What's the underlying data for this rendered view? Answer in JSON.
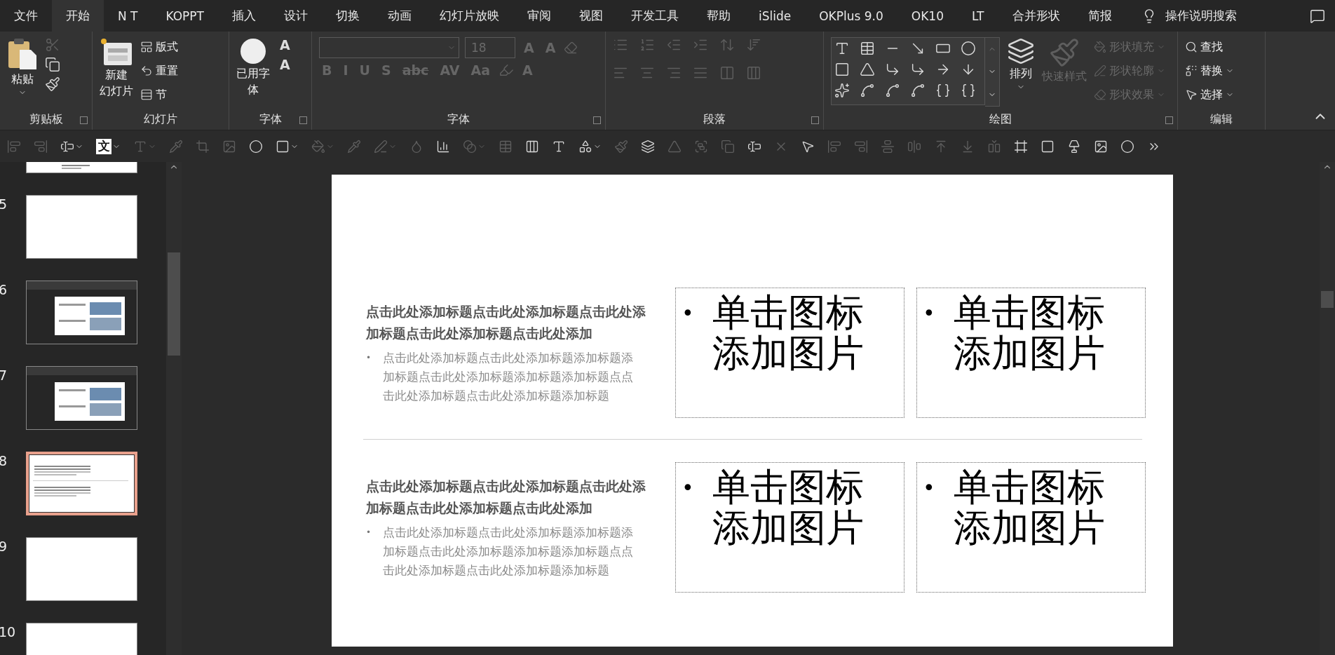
{
  "menu_tabs": [
    {
      "label": "文件",
      "selected": false
    },
    {
      "label": "开始",
      "selected": true
    },
    {
      "label": "N T",
      "selected": false
    },
    {
      "label": "KOPPT",
      "selected": false
    },
    {
      "label": "插入",
      "selected": false
    },
    {
      "label": "设计",
      "selected": false
    },
    {
      "label": "切换",
      "selected": false
    },
    {
      "label": "动画",
      "selected": false
    },
    {
      "label": "幻灯片放映",
      "selected": false
    },
    {
      "label": "审阅",
      "selected": false
    },
    {
      "label": "视图",
      "selected": false
    },
    {
      "label": "开发工具",
      "selected": false
    },
    {
      "label": "帮助",
      "selected": false
    },
    {
      "label": "iSlide",
      "selected": false
    },
    {
      "label": "OKPlus 9.0",
      "selected": false
    },
    {
      "label": "OK10",
      "selected": false
    },
    {
      "label": "LT",
      "selected": false
    },
    {
      "label": "合并形状",
      "selected": false
    },
    {
      "label": "简报",
      "selected": false
    }
  ],
  "tell_me": "操作说明搜索",
  "ribbon": {
    "groups": [
      {
        "kind": "clipboard",
        "label": "剪贴板",
        "paste": "粘贴",
        "tools": [
          {
            "disabled": true
          },
          {
            "disabled": false
          },
          {
            "disabled": false
          }
        ]
      },
      {
        "kind": "slides",
        "label": "幻灯片",
        "new_slide": [
          "新建",
          "幻灯片"
        ],
        "items": [
          "版式",
          "重置",
          "节"
        ]
      },
      {
        "kind": "fonts_used",
        "label": "字体",
        "button": [
          "已用字",
          "体"
        ],
        "size_buttons": [
          "A",
          "A"
        ]
      },
      {
        "kind": "font",
        "label": "字体",
        "font_size": "18",
        "disabled": true,
        "size_buttons": [
          "A",
          "A"
        ],
        "format_buttons": [
          "B",
          "I",
          "U",
          "S",
          "abc",
          "AV",
          "Aa"
        ],
        "color_button": "A"
      },
      {
        "kind": "paragraph",
        "label": "段落",
        "disabled": true
      },
      {
        "kind": "drawing",
        "label": "绘图",
        "arrange": "排列",
        "quick_styles": {
          "label": "快速样式",
          "disabled": true
        },
        "shape_options": [
          {
            "label": "形状填充",
            "disabled": true
          },
          {
            "label": "形状轮廓",
            "disabled": true
          },
          {
            "label": "形状效果",
            "disabled": true
          }
        ]
      },
      {
        "kind": "editing",
        "label": "编辑",
        "items": [
          "查找",
          "替换",
          "选择"
        ]
      }
    ]
  },
  "quick_toolbar": [
    {
      "kind": "icon",
      "disabled": true
    },
    {
      "kind": "icon",
      "disabled": true
    },
    {
      "kind": "icon",
      "disabled": false,
      "caret": true
    },
    {
      "kind": "glyph",
      "label": "文",
      "disabled": false,
      "caret": true
    },
    {
      "kind": "icon",
      "disabled": true,
      "caret": true
    },
    {
      "kind": "icon",
      "disabled": true
    },
    {
      "kind": "icon",
      "disabled": true
    },
    {
      "kind": "icon",
      "disabled": true
    },
    {
      "kind": "icon",
      "disabled": false
    },
    {
      "kind": "icon",
      "disabled": false,
      "caret": true
    },
    {
      "kind": "icon",
      "disabled": true,
      "caret": true
    },
    {
      "kind": "icon",
      "disabled": true
    },
    {
      "kind": "icon",
      "disabled": true,
      "caret": true
    },
    {
      "kind": "icon",
      "disabled": true
    },
    {
      "kind": "icon",
      "disabled": false
    },
    {
      "kind": "icon",
      "disabled": true,
      "caret": true
    },
    {
      "kind": "icon",
      "disabled": true
    },
    {
      "kind": "icon",
      "disabled": false
    },
    {
      "kind": "icon",
      "disabled": false
    },
    {
      "kind": "icon",
      "disabled": false,
      "caret": true
    },
    {
      "kind": "icon",
      "disabled": true
    },
    {
      "kind": "icon",
      "disabled": false
    },
    {
      "kind": "icon",
      "disabled": true
    },
    {
      "kind": "icon",
      "disabled": true
    },
    {
      "kind": "icon",
      "disabled": true
    },
    {
      "kind": "icon",
      "disabled": false
    },
    {
      "kind": "icon",
      "disabled": true
    },
    {
      "kind": "icon",
      "disabled": false
    },
    {
      "kind": "icon",
      "disabled": true
    },
    {
      "kind": "icon",
      "disabled": true
    },
    {
      "kind": "icon",
      "disabled": true
    },
    {
      "kind": "icon",
      "disabled": true
    },
    {
      "kind": "icon",
      "disabled": true
    },
    {
      "kind": "icon",
      "disabled": true
    },
    {
      "kind": "icon",
      "disabled": true
    },
    {
      "kind": "icon",
      "disabled": false
    },
    {
      "kind": "icon",
      "disabled": false
    },
    {
      "kind": "icon",
      "disabled": false
    },
    {
      "kind": "icon",
      "disabled": false
    },
    {
      "kind": "icon",
      "disabled": false
    },
    {
      "kind": "icon",
      "disabled": false
    }
  ],
  "thumbnails": [
    {
      "kind": "footer_text",
      "selected": false
    },
    {
      "number": "5",
      "kind": "blank",
      "selected": false
    },
    {
      "number": "6",
      "kind": "screenshot",
      "selected": false
    },
    {
      "number": "7",
      "kind": "screenshot",
      "selected": false
    },
    {
      "number": "8",
      "kind": "text",
      "selected": true
    },
    {
      "number": "9",
      "kind": "blank",
      "selected": false
    },
    {
      "number": "10",
      "kind": "blank",
      "selected": false
    }
  ],
  "slide": {
    "rows": [
      {
        "title": "点击此处添加标题点击此处添加标题点击此处添加标题点击此处添加标题点击此处添加",
        "bullet": "•",
        "body": "点击此处添加标题点击此处添加标题添加标题添加标题点击此处添加标题添加标题添加标题点点击此处添加标题点击此处添加标题添加标题",
        "placeholders": [
          {
            "bullet": "•",
            "text": "单击图标添加图片"
          },
          {
            "bullet": "•",
            "text": "单击图标添加图片"
          }
        ]
      },
      {
        "title": "点击此处添加标题点击此处添加标题点击此处添加标题点击此处添加标题点击此处添加",
        "bullet": "•",
        "body": "点击此处添加标题点击此处添加标题添加标题添加标题点击此处添加标题添加标题添加标题点点击此处添加标题点击此处添加标题添加标题",
        "placeholders": [
          {
            "bullet": "•",
            "text": "单击图标添加图片"
          },
          {
            "bullet": "•",
            "text": "单击图标添加图片"
          }
        ]
      }
    ]
  }
}
